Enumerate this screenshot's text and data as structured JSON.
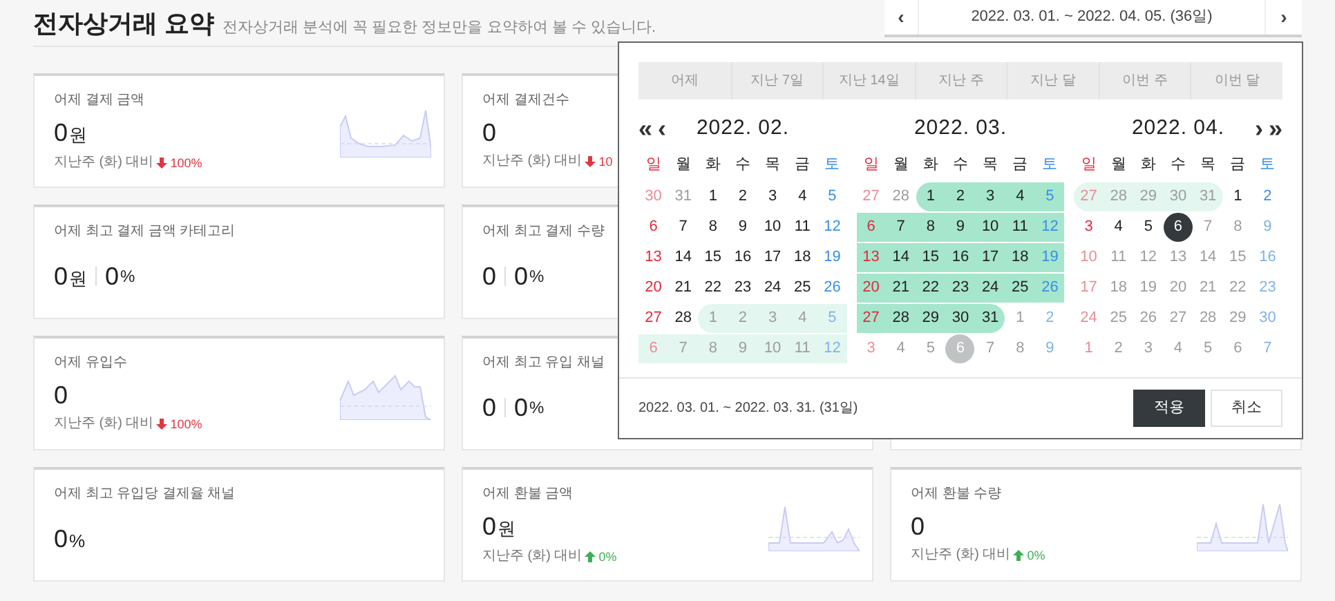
{
  "header": {
    "title": "전자상거래 요약",
    "subtitle": "전자상거래 분석에 꼭 필요한 정보만을 요약하여 볼 수 있습니다."
  },
  "date_range": {
    "prev": "‹",
    "text": "2022. 03. 01. ~ 2022. 04. 05. (36일)",
    "next": "›"
  },
  "cards": [
    [
      {
        "kind": "trend",
        "title": "어제 결제 금액",
        "value": "0",
        "unit": "원",
        "compare_label": "지난주 (화) 대비",
        "up": false,
        "change": "100%",
        "sparkline": true
      },
      {
        "kind": "trend",
        "title": "어제 결제건수",
        "value": "0",
        "compare_label": "지난주 (화) 대비",
        "up": false,
        "change": "10",
        "sparkline": false
      }
    ],
    [
      {
        "kind": "split",
        "title": "어제 최고 결제 금액 카테고리",
        "value": "0",
        "unit": "원",
        "share": "0",
        "share_unit": "%"
      },
      {
        "kind": "split",
        "title": "어제 최고 결제 수량",
        "value": "0",
        "share": "0",
        "share_unit": "%"
      }
    ],
    [
      {
        "kind": "trend",
        "title": "어제 유입수",
        "value": "0",
        "compare_label": "지난주 (화) 대비",
        "up": false,
        "change": "100%",
        "sparkline": true
      },
      {
        "kind": "split",
        "title": "어제 최고 유입 채널",
        "value": "0",
        "share": "0",
        "share_unit": "%"
      }
    ],
    [
      {
        "kind": "percent",
        "title": "어제 최고 유입당 결제율 채널",
        "value": "0",
        "unit": "%"
      },
      {
        "kind": "trend",
        "title": "어제 환불 금액",
        "value": "0",
        "unit": "원",
        "compare_label": "지난주 (화) 대비",
        "up": true,
        "change": "0%",
        "sparkline": true
      },
      {
        "kind": "trend",
        "title": "어제 환불 수량",
        "value": "0",
        "compare_label": "지난주 (화) 대비",
        "up": true,
        "change": "0%",
        "sparkline": true
      }
    ]
  ],
  "calendar": {
    "presets": [
      {
        "label": "어제",
        "selected": false
      },
      {
        "label": "지난 7일",
        "selected": false
      },
      {
        "label": "지난 14일",
        "selected": false
      },
      {
        "label": "지난 주",
        "selected": false
      },
      {
        "label": "지난 달",
        "selected": false
      },
      {
        "label": "이번 주",
        "selected": false
      },
      {
        "label": "이번 달",
        "selected": false
      }
    ],
    "nav": {
      "first": "«",
      "prev": "‹",
      "next": "›",
      "last": "»"
    },
    "months": [
      {
        "title": "2022. 02.",
        "weekdays": [
          "일",
          "월",
          "화",
          "수",
          "목",
          "금",
          "토"
        ],
        "weeks": [
          [
            {
              "label": "30",
              "muted": true,
              "selected": false,
              "in_range": false,
              "today": false
            },
            {
              "label": "31",
              "muted": true,
              "selected": false,
              "in_range": false,
              "today": false
            },
            {
              "label": "1",
              "muted": false,
              "selected": false,
              "in_range": false,
              "today": false
            },
            {
              "label": "2",
              "muted": false,
              "selected": false,
              "in_range": false,
              "today": false
            },
            {
              "label": "3",
              "muted": false,
              "selected": false,
              "in_range": false,
              "today": false
            },
            {
              "label": "4",
              "muted": false,
              "selected": false,
              "in_range": false,
              "today": false
            },
            {
              "label": "5",
              "muted": false,
              "selected": false,
              "in_range": false,
              "today": false
            }
          ],
          [
            {
              "label": "6",
              "muted": false,
              "selected": false,
              "in_range": false,
              "today": false
            },
            {
              "label": "7",
              "muted": false,
              "selected": false,
              "in_range": false,
              "today": false
            },
            {
              "label": "8",
              "muted": false,
              "selected": false,
              "in_range": false,
              "today": false
            },
            {
              "label": "9",
              "muted": false,
              "selected": false,
              "in_range": false,
              "today": false
            },
            {
              "label": "10",
              "muted": false,
              "selected": false,
              "in_range": false,
              "today": false
            },
            {
              "label": "11",
              "muted": false,
              "selected": false,
              "in_range": false,
              "today": false
            },
            {
              "label": "12",
              "muted": false,
              "selected": false,
              "in_range": false,
              "today": false
            }
          ],
          [
            {
              "label": "13",
              "muted": false,
              "selected": false,
              "in_range": false,
              "today": false
            },
            {
              "label": "14",
              "muted": false,
              "selected": false,
              "in_range": false,
              "today": false
            },
            {
              "label": "15",
              "muted": false,
              "selected": false,
              "in_range": false,
              "today": false
            },
            {
              "label": "16",
              "muted": false,
              "selected": false,
              "in_range": false,
              "today": false
            },
            {
              "label": "17",
              "muted": false,
              "selected": false,
              "in_range": false,
              "today": false
            },
            {
              "label": "18",
              "muted": false,
              "selected": false,
              "in_range": false,
              "today": false
            },
            {
              "label": "19",
              "muted": false,
              "selected": false,
              "in_range": false,
              "today": false
            }
          ],
          [
            {
              "label": "20",
              "muted": false,
              "selected": false,
              "in_range": false,
              "today": false
            },
            {
              "label": "21",
              "muted": false,
              "selected": false,
              "in_range": false,
              "today": false
            },
            {
              "label": "22",
              "muted": false,
              "selected": false,
              "in_range": false,
              "today": false
            },
            {
              "label": "23",
              "muted": false,
              "selected": false,
              "in_range": false,
              "today": false
            },
            {
              "label": "24",
              "muted": false,
              "selected": false,
              "in_range": false,
              "today": false
            },
            {
              "label": "25",
              "muted": false,
              "selected": false,
              "in_range": false,
              "today": false
            },
            {
              "label": "26",
              "muted": false,
              "selected": false,
              "in_range": false,
              "today": false
            }
          ],
          [
            {
              "label": "27",
              "muted": false,
              "selected": false,
              "in_range": false,
              "today": false
            },
            {
              "label": "28",
              "muted": false,
              "selected": false,
              "in_range": false,
              "today": false
            },
            {
              "label": "1",
              "muted": true,
              "selected": false,
              "in_range": true,
              "today": false
            },
            {
              "label": "2",
              "muted": true,
              "selected": false,
              "in_range": true,
              "today": false
            },
            {
              "label": "3",
              "muted": true,
              "selected": false,
              "in_range": true,
              "today": false
            },
            {
              "label": "4",
              "muted": true,
              "selected": false,
              "in_range": true,
              "today": false
            },
            {
              "label": "5",
              "muted": true,
              "selected": false,
              "in_range": true,
              "today": false
            }
          ],
          [
            {
              "label": "6",
              "muted": true,
              "selected": false,
              "in_range": true,
              "today": false
            },
            {
              "label": "7",
              "muted": true,
              "selected": false,
              "in_range": true,
              "today": false
            },
            {
              "label": "8",
              "muted": true,
              "selected": false,
              "in_range": true,
              "today": false
            },
            {
              "label": "9",
              "muted": true,
              "selected": false,
              "in_range": true,
              "today": false
            },
            {
              "label": "10",
              "muted": true,
              "selected": false,
              "in_range": true,
              "today": false
            },
            {
              "label": "11",
              "muted": true,
              "selected": false,
              "in_range": true,
              "today": false
            },
            {
              "label": "12",
              "muted": true,
              "selected": false,
              "in_range": true,
              "today": false
            }
          ]
        ]
      },
      {
        "title": "2022. 03.",
        "weekdays": [
          "일",
          "월",
          "화",
          "수",
          "목",
          "금",
          "토"
        ],
        "weeks": [
          [
            {
              "label": "27",
              "muted": true,
              "selected": false,
              "in_range": false,
              "today": false
            },
            {
              "label": "28",
              "muted": true,
              "selected": false,
              "in_range": false,
              "today": false
            },
            {
              "label": "1",
              "muted": false,
              "selected": true,
              "in_range": false,
              "today": false
            },
            {
              "label": "2",
              "muted": false,
              "selected": true,
              "in_range": false,
              "today": false
            },
            {
              "label": "3",
              "muted": false,
              "selected": true,
              "in_range": false,
              "today": false
            },
            {
              "label": "4",
              "muted": false,
              "selected": true,
              "in_range": false,
              "today": false
            },
            {
              "label": "5",
              "muted": false,
              "selected": true,
              "in_range": false,
              "today": false
            }
          ],
          [
            {
              "label": "6",
              "muted": false,
              "selected": true,
              "in_range": false,
              "today": false
            },
            {
              "label": "7",
              "muted": false,
              "selected": true,
              "in_range": false,
              "today": false
            },
            {
              "label": "8",
              "muted": false,
              "selected": true,
              "in_range": false,
              "today": false
            },
            {
              "label": "9",
              "muted": false,
              "selected": true,
              "in_range": false,
              "today": false
            },
            {
              "label": "10",
              "muted": false,
              "selected": true,
              "in_range": false,
              "today": false
            },
            {
              "label": "11",
              "muted": false,
              "selected": true,
              "in_range": false,
              "today": false
            },
            {
              "label": "12",
              "muted": false,
              "selected": true,
              "in_range": false,
              "today": false
            }
          ],
          [
            {
              "label": "13",
              "muted": false,
              "selected": true,
              "in_range": false,
              "today": false
            },
            {
              "label": "14",
              "muted": false,
              "selected": true,
              "in_range": false,
              "today": false
            },
            {
              "label": "15",
              "muted": false,
              "selected": true,
              "in_range": false,
              "today": false
            },
            {
              "label": "16",
              "muted": false,
              "selected": true,
              "in_range": false,
              "today": false
            },
            {
              "label": "17",
              "muted": false,
              "selected": true,
              "in_range": false,
              "today": false
            },
            {
              "label": "18",
              "muted": false,
              "selected": true,
              "in_range": false,
              "today": false
            },
            {
              "label": "19",
              "muted": false,
              "selected": true,
              "in_range": false,
              "today": false
            }
          ],
          [
            {
              "label": "20",
              "muted": false,
              "selected": true,
              "in_range": false,
              "today": false
            },
            {
              "label": "21",
              "muted": false,
              "selected": true,
              "in_range": false,
              "today": false
            },
            {
              "label": "22",
              "muted": false,
              "selected": true,
              "in_range": false,
              "today": false
            },
            {
              "label": "23",
              "muted": false,
              "selected": true,
              "in_range": false,
              "today": false
            },
            {
              "label": "24",
              "muted": false,
              "selected": true,
              "in_range": false,
              "today": false
            },
            {
              "label": "25",
              "muted": false,
              "selected": true,
              "in_range": false,
              "today": false
            },
            {
              "label": "26",
              "muted": false,
              "selected": true,
              "in_range": false,
              "today": false
            }
          ],
          [
            {
              "label": "27",
              "muted": false,
              "selected": true,
              "in_range": false,
              "today": false
            },
            {
              "label": "28",
              "muted": false,
              "selected": true,
              "in_range": false,
              "today": false
            },
            {
              "label": "29",
              "muted": false,
              "selected": true,
              "in_range": false,
              "today": false
            },
            {
              "label": "30",
              "muted": false,
              "selected": true,
              "in_range": false,
              "today": false
            },
            {
              "label": "31",
              "muted": false,
              "selected": true,
              "in_range": false,
              "today": false
            },
            {
              "label": "1",
              "muted": true,
              "selected": false,
              "in_range": false,
              "today": false
            },
            {
              "label": "2",
              "muted": true,
              "selected": false,
              "in_range": false,
              "today": false
            }
          ],
          [
            {
              "label": "3",
              "muted": true,
              "selected": false,
              "in_range": false,
              "today": false
            },
            {
              "label": "4",
              "muted": true,
              "selected": false,
              "in_range": false,
              "today": false
            },
            {
              "label": "5",
              "muted": true,
              "selected": false,
              "in_range": false,
              "today": false
            },
            {
              "label": "6",
              "muted": true,
              "selected": false,
              "in_range": false,
              "today": true
            },
            {
              "label": "7",
              "muted": true,
              "selected": false,
              "in_range": false,
              "today": false
            },
            {
              "label": "8",
              "muted": true,
              "selected": false,
              "in_range": false,
              "today": false
            },
            {
              "label": "9",
              "muted": true,
              "selected": false,
              "in_range": false,
              "today": false
            }
          ]
        ]
      },
      {
        "title": "2022. 04.",
        "weekdays": [
          "일",
          "월",
          "화",
          "수",
          "목",
          "금",
          "토"
        ],
        "weeks": [
          [
            {
              "label": "27",
              "muted": true,
              "selected": false,
              "in_range": true,
              "today": false
            },
            {
              "label": "28",
              "muted": true,
              "selected": false,
              "in_range": true,
              "today": false
            },
            {
              "label": "29",
              "muted": true,
              "selected": false,
              "in_range": true,
              "today": false
            },
            {
              "label": "30",
              "muted": true,
              "selected": false,
              "in_range": true,
              "today": false
            },
            {
              "label": "31",
              "muted": true,
              "selected": false,
              "in_range": true,
              "today": false
            },
            {
              "label": "1",
              "muted": false,
              "selected": false,
              "in_range": false,
              "today": false
            },
            {
              "label": "2",
              "muted": false,
              "selected": false,
              "in_range": false,
              "today": false
            }
          ],
          [
            {
              "label": "3",
              "muted": false,
              "selected": false,
              "in_range": false,
              "today": false
            },
            {
              "label": "4",
              "muted": false,
              "selected": false,
              "in_range": false,
              "today": false
            },
            {
              "label": "5",
              "muted": false,
              "selected": false,
              "in_range": false,
              "today": false
            },
            {
              "label": "6",
              "muted": false,
              "selected": false,
              "in_range": false,
              "today": true
            },
            {
              "label": "7",
              "muted": true,
              "selected": false,
              "in_range": false,
              "today": false
            },
            {
              "label": "8",
              "muted": true,
              "selected": false,
              "in_range": false,
              "today": false
            },
            {
              "label": "9",
              "muted": true,
              "selected": false,
              "in_range": false,
              "today": false
            }
          ],
          [
            {
              "label": "10",
              "muted": true,
              "selected": false,
              "in_range": false,
              "today": false
            },
            {
              "label": "11",
              "muted": true,
              "selected": false,
              "in_range": false,
              "today": false
            },
            {
              "label": "12",
              "muted": true,
              "selected": false,
              "in_range": false,
              "today": false
            },
            {
              "label": "13",
              "muted": true,
              "selected": false,
              "in_range": false,
              "today": false
            },
            {
              "label": "14",
              "muted": true,
              "selected": false,
              "in_range": false,
              "today": false
            },
            {
              "label": "15",
              "muted": true,
              "selected": false,
              "in_range": false,
              "today": false
            },
            {
              "label": "16",
              "muted": true,
              "selected": false,
              "in_range": false,
              "today": false
            }
          ],
          [
            {
              "label": "17",
              "muted": true,
              "selected": false,
              "in_range": false,
              "today": false
            },
            {
              "label": "18",
              "muted": true,
              "selected": false,
              "in_range": false,
              "today": false
            },
            {
              "label": "19",
              "muted": true,
              "selected": false,
              "in_range": false,
              "today": false
            },
            {
              "label": "20",
              "muted": true,
              "selected": false,
              "in_range": false,
              "today": false
            },
            {
              "label": "21",
              "muted": true,
              "selected": false,
              "in_range": false,
              "today": false
            },
            {
              "label": "22",
              "muted": true,
              "selected": false,
              "in_range": false,
              "today": false
            },
            {
              "label": "23",
              "muted": true,
              "selected": false,
              "in_range": false,
              "today": false
            }
          ],
          [
            {
              "label": "24",
              "muted": true,
              "selected": false,
              "in_range": false,
              "today": false
            },
            {
              "label": "25",
              "muted": true,
              "selected": false,
              "in_range": false,
              "today": false
            },
            {
              "label": "26",
              "muted": true,
              "selected": false,
              "in_range": false,
              "today": false
            },
            {
              "label": "27",
              "muted": true,
              "selected": false,
              "in_range": false,
              "today": false
            },
            {
              "label": "28",
              "muted": true,
              "selected": false,
              "in_range": false,
              "today": false
            },
            {
              "label": "29",
              "muted": true,
              "selected": false,
              "in_range": false,
              "today": false
            },
            {
              "label": "30",
              "muted": true,
              "selected": false,
              "in_range": false,
              "today": false
            }
          ],
          [
            {
              "label": "1",
              "muted": true,
              "selected": false,
              "in_range": false,
              "today": false
            },
            {
              "label": "2",
              "muted": true,
              "selected": false,
              "in_range": false,
              "today": false
            },
            {
              "label": "3",
              "muted": true,
              "selected": false,
              "in_range": false,
              "today": false
            },
            {
              "label": "4",
              "muted": true,
              "selected": false,
              "in_range": false,
              "today": false
            },
            {
              "label": "5",
              "muted": true,
              "selected": false,
              "in_range": false,
              "today": false
            },
            {
              "label": "6",
              "muted": true,
              "selected": false,
              "in_range": false,
              "today": false
            },
            {
              "label": "7",
              "muted": true,
              "selected": false,
              "in_range": false,
              "today": false
            }
          ]
        ]
      }
    ],
    "summary": "2022. 03. 01. ~ 2022. 03. 31. (31일)",
    "buttons": [
      {
        "label": "적용",
        "kind": "primary"
      },
      {
        "label": "취소",
        "kind": "secondary"
      }
    ]
  }
}
